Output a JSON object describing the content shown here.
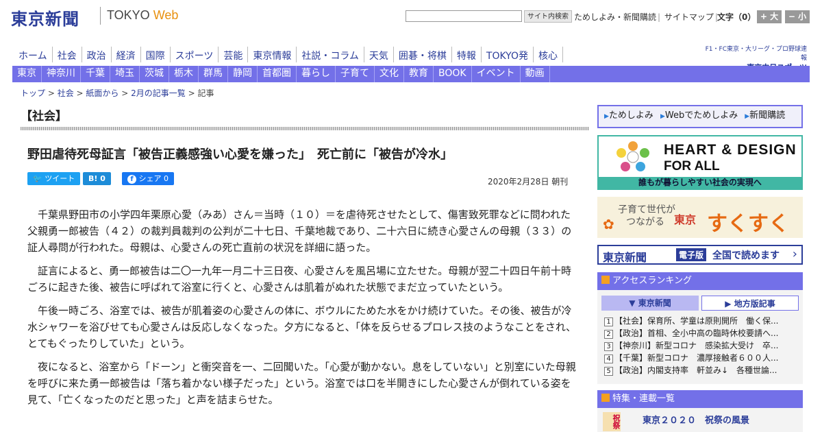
{
  "header": {
    "logo": "東京新聞",
    "logo_sub_prefix": "TOKYO",
    "logo_sub_suffix": "Web",
    "search_button": "サイト内検索",
    "links": [
      "ためしよみ・新聞購読",
      "サイトマップ"
    ],
    "font_size_label": "文字（0）",
    "font_plus": "+ 大",
    "font_minus": "− 小"
  },
  "nav_main": [
    "ホーム",
    "社会",
    "政治",
    "経済",
    "国際",
    "スポーツ",
    "芸能",
    "東京情報",
    "社説・コラム",
    "天気",
    "囲碁・将棋",
    "特報",
    "TOKYO発",
    "核心"
  ],
  "sports_link": {
    "line1": "F1・FC東京・大リーグ・プロ野球速報",
    "line2": "東京中日スポーツ"
  },
  "nav_sub": [
    "東京",
    "神奈川",
    "千葉",
    "埼玉",
    "茨城",
    "栃木",
    "群馬",
    "静岡",
    "首都圏",
    "暮らし",
    "子育て",
    "文化",
    "教育",
    "BOOK",
    "イベント",
    "動画"
  ],
  "breadcrumb": [
    "トップ",
    "社会",
    "紙面から",
    "2月の記事一覧",
    "記事"
  ],
  "section_label": "【社会】",
  "article": {
    "title": "野田虐待死母証言「被告正義感強い心愛を嫌った」　死亡前に「被告が冷水」",
    "tweet": "ツイート",
    "hatena": "B! 0",
    "share": "シェア 0",
    "date": "2020年2月28日 朝刊",
    "paragraphs": [
      "千葉県野田市の小学四年栗原心愛（みあ）さん＝当時（１０）＝を虐待死させたとして、傷害致死罪などに問われた父親勇一郎被告（４２）の裁判員裁判の公判が二十七日、千葉地裁であり、二十六日に続き心愛さんの母親（３３）の証人尋問が行われた。母親は、心愛さんの死亡直前の状況を詳細に語った。",
      "証言によると、勇一郎被告は二〇一九年一月二十三日夜、心愛さんを風呂場に立たせた。母親が翌二十四日午前十時ごろに起きた後、被告に呼ばれて浴室に行くと、心愛さんは肌着がぬれた状態でまだ立っていたという。",
      "午後一時ごろ、浴室では、被告が肌着姿の心愛さんの体に、ボウルにためた水をかけ続けていた。その後、被告が冷水シャワーを浴びせても心愛さんは反応しなくなった。夕方になると、「体を反らせるプロレス技のようなことをされ、とてもぐったりしていた」という。",
      "夜になると、浴室から「ドーン」と衝突音を一、二回聞いた。「心愛が動かない。息をしていない」と別室にいた母親を呼びに来た勇一郎被告は「落ち着かない様子だった」という。浴室では口を半開きにした心愛さんが倒れている姿を見て、「亡くなったのだと思った」と声を詰まらせた。"
    ]
  },
  "sidebar": {
    "tameshi": [
      "ためしよみ",
      "Webでためしよみ",
      "新聞購読"
    ],
    "heart_line1": "HEART & DESIGN",
    "heart_line2": "FOR ALL",
    "heart_bar": "誰もが暮らしやすい社会の実現へ",
    "suku_line1": "子育て世代が",
    "suku_line2": "つながる",
    "suku_tokyo": "東京",
    "suku_big": "すくすく",
    "denshi_logo": "東京新聞",
    "denshi_badge": "電子版",
    "denshi_text": "全国で読めます",
    "ranking_title": "アクセスランキング",
    "ranking_tabs": [
      "東京新聞",
      "地方版記事"
    ],
    "ranking": [
      "【社会】保育所、学童は原則開所　働く保...",
      "【政治】首相、全小中高の臨時休校要請へ...",
      "【神奈川】新型コロナ　感染拡大受け　卒...",
      "【千葉】新型コロナ　濃厚接触者６００人...",
      "【政治】内閣支持率　軒並み↓　各種世論..."
    ],
    "feature_title": "特集・連載一覧",
    "feature_item": "東京２０２０　祝祭の風景",
    "feature_thumb": "祝祭"
  }
}
